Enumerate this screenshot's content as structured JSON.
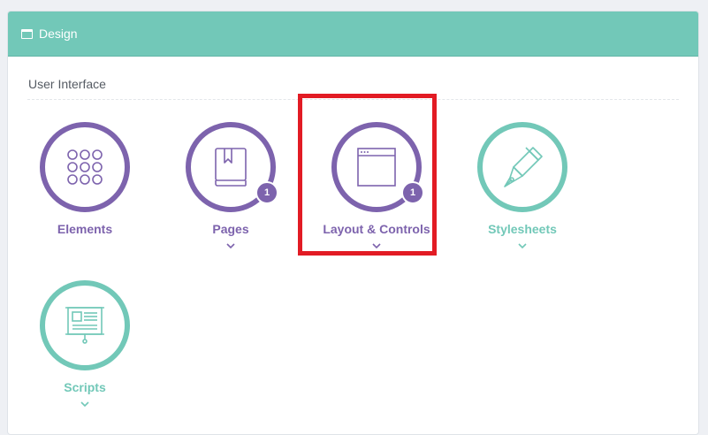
{
  "panel": {
    "title": "Design",
    "title_icon": "window-icon",
    "header_color": "#72c8b8"
  },
  "section": {
    "label": "User Interface"
  },
  "tiles": [
    {
      "label": "Elements",
      "icon": "grid-dots-icon",
      "color": "#7d63ad",
      "badge": null,
      "has_chevron": false
    },
    {
      "label": "Pages",
      "icon": "book-icon",
      "color": "#7d63ad",
      "badge": "1",
      "has_chevron": true
    },
    {
      "label": "Layout & Controls",
      "icon": "browser-window-icon",
      "color": "#7d63ad",
      "badge": "1",
      "has_chevron": true,
      "highlighted": true
    },
    {
      "label": "Stylesheets",
      "icon": "pen-icon",
      "color": "#72c8b8",
      "badge": null,
      "has_chevron": true
    },
    {
      "label": "Scripts",
      "icon": "presentation-board-icon",
      "color": "#72c8b8",
      "badge": null,
      "has_chevron": true
    }
  ],
  "highlight_color": "#e21b24"
}
